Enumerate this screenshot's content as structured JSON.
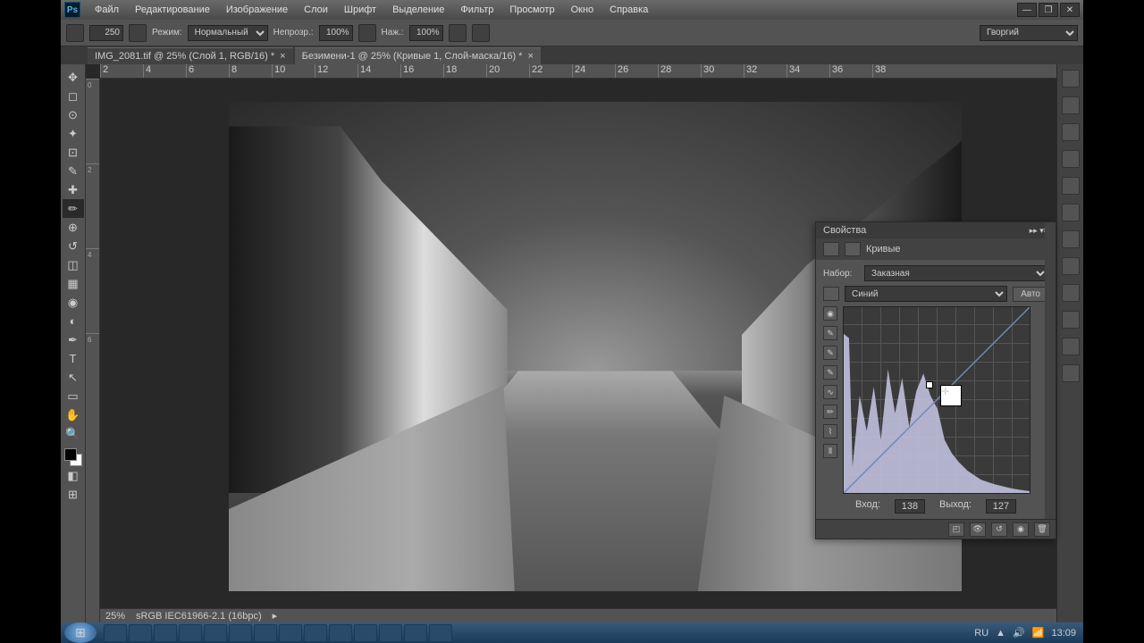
{
  "menu": {
    "file": "Файл",
    "edit": "Редактирование",
    "image": "Изображение",
    "layer": "Слои",
    "type": "Шрифт",
    "select": "Выделение",
    "filter": "Фильтр",
    "view": "Просмотр",
    "window": "Окно",
    "help": "Справка"
  },
  "options": {
    "mode_label": "Режим:",
    "mode_value": "Нормальный",
    "opacity_label": "Непрозр.:",
    "opacity_value": "100%",
    "flow_label": "Наж.:",
    "flow_value": "100%",
    "brush_size": "250",
    "workspace": "Гворгий"
  },
  "tabs": {
    "t1": "IMG_2081.tif @ 25% (Слой 1, RGB/16) *",
    "t2": "Безимени-1 @ 25% (Кривые 1, Слой-маска/16) *"
  },
  "ruler": {
    "h": [
      "2",
      "4",
      "6",
      "8",
      "10",
      "12",
      "14",
      "16",
      "18",
      "20",
      "22",
      "24",
      "26",
      "28",
      "30",
      "32",
      "34",
      "36",
      "38"
    ],
    "v": [
      "0",
      "2",
      "4",
      "6"
    ]
  },
  "status": {
    "zoom": "25%",
    "profile": "sRGB IEC61966-2.1 (16bpc)"
  },
  "panel": {
    "title": "Свойства",
    "type": "Кривые",
    "preset_label": "Набор:",
    "preset_value": "Заказная",
    "channel_value": "Синий",
    "auto": "Авто",
    "input_label": "Вход:",
    "input_value": "138",
    "output_label": "Выход:",
    "output_value": "127"
  },
  "tray": {
    "lang": "RU",
    "time": "13:09"
  }
}
